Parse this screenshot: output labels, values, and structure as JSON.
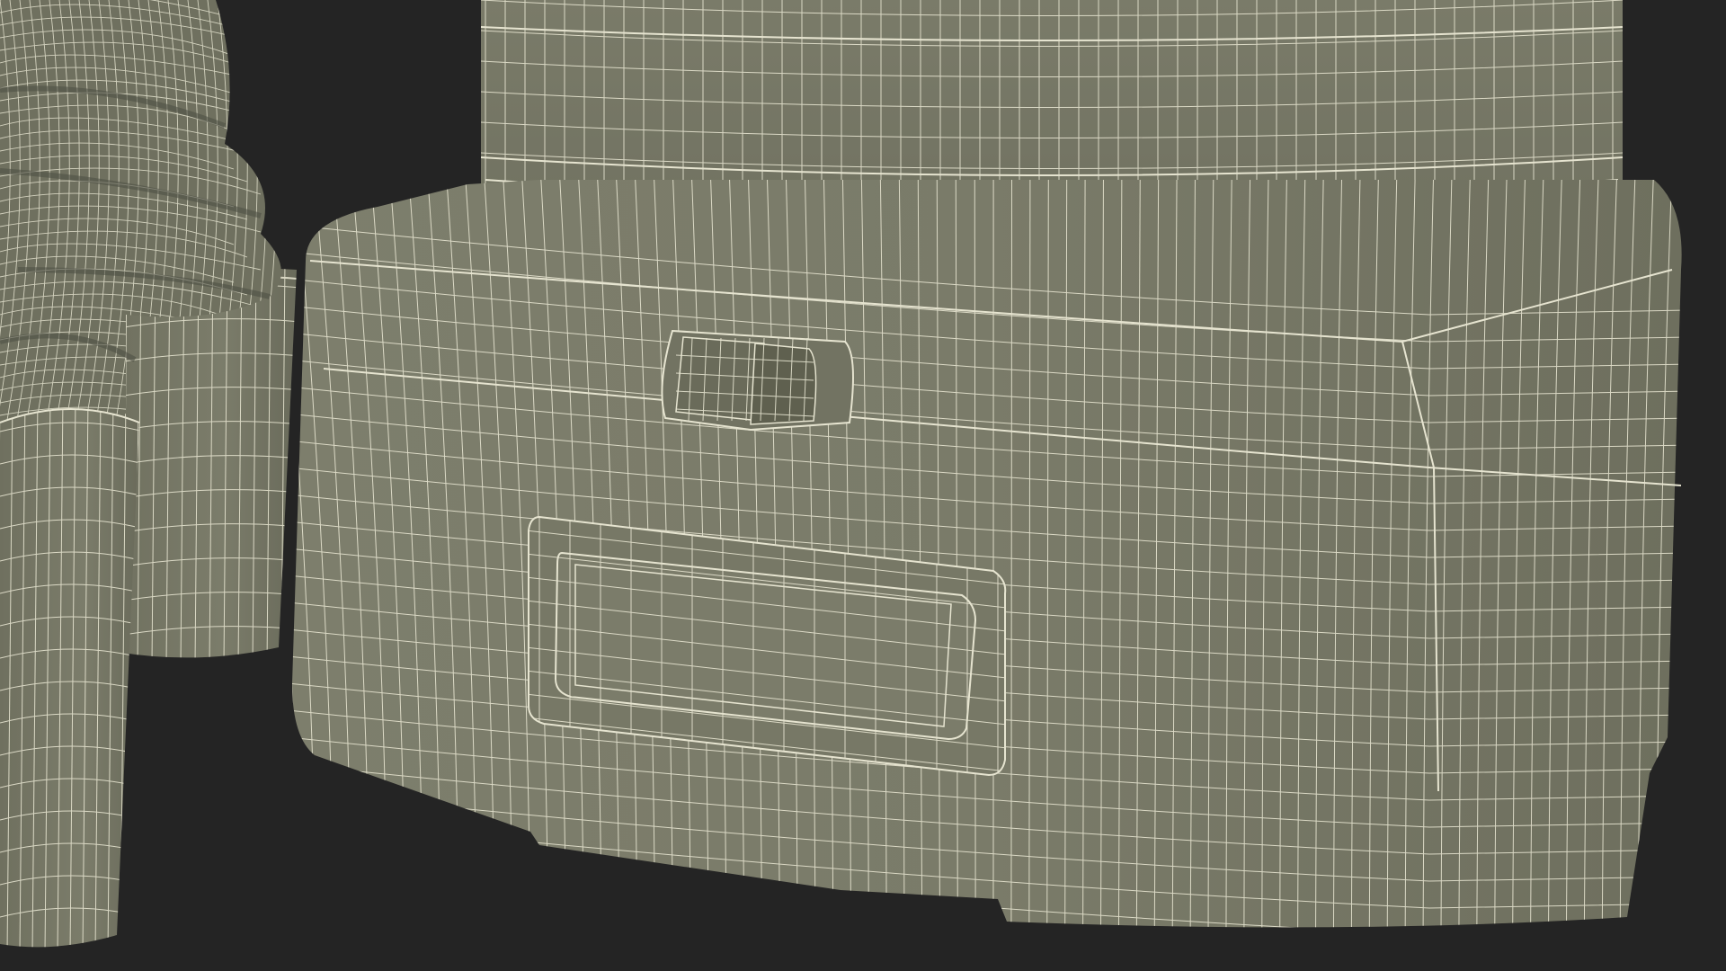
{
  "scene": {
    "background_color": "#242424",
    "mesh_fill_color": "#7b7b69",
    "mesh_shade_color": "#5d5e50",
    "wire_color": "#e6e4d0",
    "objects": [
      "swirl-cup-back",
      "swirl-cup-front",
      "machine-tank",
      "machine-base",
      "control-switch",
      "display-panel"
    ]
  }
}
